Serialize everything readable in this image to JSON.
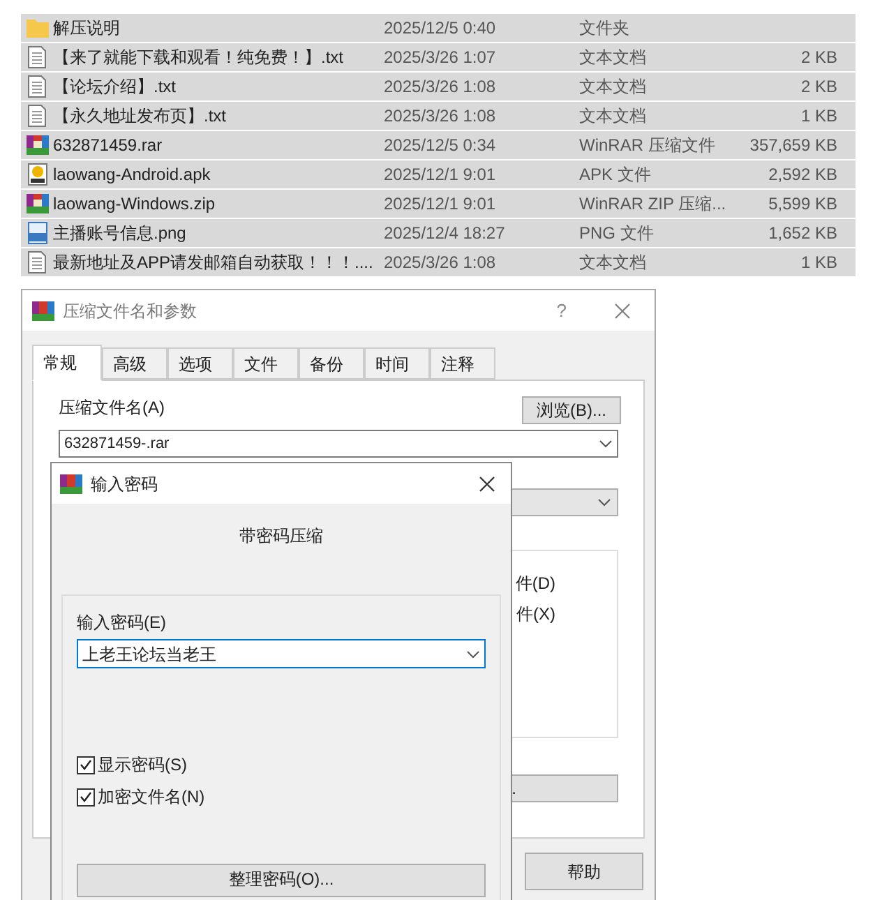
{
  "files": [
    {
      "kind": "folder",
      "name": "解压说明",
      "date": "2025/12/5 0:40",
      "type": "文件夹",
      "selected": true
    },
    {
      "kind": "text",
      "name": "【来了就能下载和观看！纯免费！】.txt",
      "date": "2025/3/26 1:07",
      "type": "文本文档",
      "size": "2 KB",
      "selected": true
    },
    {
      "kind": "text",
      "name": "【论坛介绍】.txt",
      "date": "2025/3/26 1:08",
      "type": "文本文档",
      "size": "2 KB",
      "selected": true
    },
    {
      "kind": "text",
      "name": "【永久地址发布页】.txt",
      "date": "2025/3/26 1:08",
      "type": "文本文档",
      "size": "1 KB",
      "selected": true
    },
    {
      "kind": "archive",
      "name": "632871459.rar",
      "date": "2025/12/5 0:34",
      "type": "WinRAR 压缩文件",
      "size": "357,659 KB",
      "selected": true
    },
    {
      "kind": "apk",
      "name": "laowang-Android.apk",
      "date": "2025/12/1 9:01",
      "type": "APK 文件",
      "size": "2,592 KB",
      "selected": true
    },
    {
      "kind": "archive",
      "name": "laowang-Windows.zip",
      "date": "2025/12/1 9:01",
      "type": "WinRAR ZIP 压缩...",
      "size": "5,599 KB",
      "selected": true
    },
    {
      "kind": "image",
      "name": "主播账号信息.png",
      "date": "2025/12/4 18:27",
      "type": "PNG 文件",
      "size": "1,652 KB",
      "selected": true
    },
    {
      "kind": "text",
      "name": "最新地址及APP请发邮箱自动获取！！！....",
      "date": "2025/3/26 1:08",
      "type": "文本文档",
      "size": "1 KB",
      "selected": true
    }
  ],
  "archive_dialog": {
    "title": "压缩文件名和参数",
    "help_glyph": "?",
    "tabs": [
      {
        "label": "常规",
        "selected": true
      },
      {
        "label": "高级",
        "selected": false
      },
      {
        "label": "选项",
        "selected": false
      },
      {
        "label": "文件",
        "selected": false
      },
      {
        "label": "备份",
        "selected": false
      },
      {
        "label": "时间",
        "selected": false
      },
      {
        "label": "注释",
        "selected": false
      }
    ],
    "archive_name_label": "压缩文件名(A)",
    "browse_button": "浏览(B)...",
    "archive_name": "632871459-.rar",
    "option_fragments": [
      "件(D)",
      "件(X)"
    ],
    "partial_button": ".",
    "help_button": "帮助"
  },
  "password_dialog": {
    "title": "输入密码",
    "heading": "带密码压缩",
    "password_label": "输入密码(E)",
    "password": "上老王论坛当老王",
    "checkboxes": [
      {
        "label": "显示密码(S)",
        "checked": true
      },
      {
        "label": "加密文件名(N)",
        "checked": true
      }
    ],
    "organize_button": "整理密码(O)..."
  }
}
